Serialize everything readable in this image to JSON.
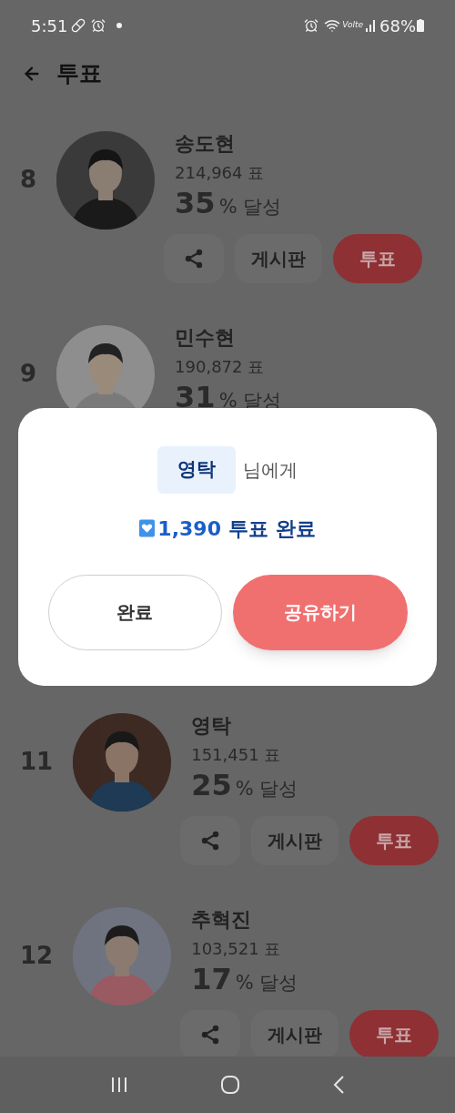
{
  "status_bar": {
    "time": "5:51",
    "network": "Volte",
    "battery": "68%"
  },
  "header": {
    "title": "투표"
  },
  "rows_above": [
    {
      "rank": "8",
      "name": "송도현",
      "votes": "214,964 표",
      "percent": "35",
      "percent_suffix": "% 달성",
      "buttons": [
        {
          "kind": "share"
        },
        {
          "kind": "board",
          "label": "게시판"
        },
        {
          "kind": "vote",
          "label": "투표"
        }
      ]
    },
    {
      "rank": "9",
      "name": "민수현",
      "votes": "190,872 표",
      "percent": "31",
      "percent_suffix": "% 달성"
    }
  ],
  "rows_below": [
    {
      "rank": "11",
      "name": "영탁",
      "votes": "151,451 표",
      "percent": "25",
      "percent_suffix": "% 달성",
      "buttons": [
        {
          "kind": "share"
        },
        {
          "kind": "board",
          "label": "게시판"
        },
        {
          "kind": "vote",
          "label": "투표"
        }
      ]
    },
    {
      "rank": "12",
      "name": "추혁진",
      "votes": "103,521 표",
      "percent": "17",
      "percent_suffix": "% 달성",
      "buttons": [
        {
          "kind": "share"
        },
        {
          "kind": "board",
          "label": "게시판"
        },
        {
          "kind": "vote",
          "label": "투표"
        }
      ]
    }
  ],
  "dialog": {
    "recipient": "영탁",
    "recipient_suffix": "님에게",
    "count": "1,390",
    "count_label": "투표 완료",
    "buttons": [
      {
        "kind": "secondary",
        "label": "완료"
      },
      {
        "kind": "primary",
        "label": "공유하기"
      }
    ]
  }
}
